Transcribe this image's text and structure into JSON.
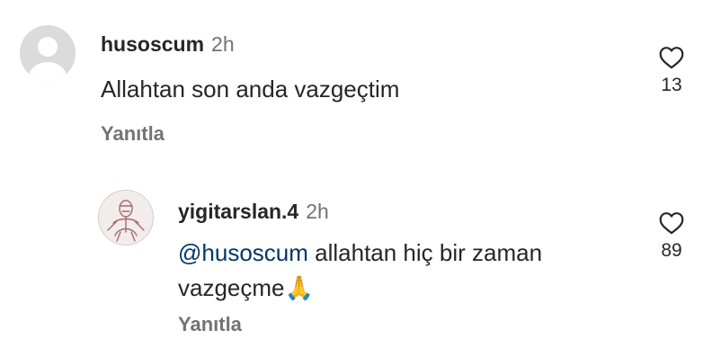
{
  "comments": [
    {
      "username": "husoscum",
      "time": "2h",
      "text": "Allahtan son anda vazgeçtim",
      "reply_label": "Yanıtla",
      "like_count": "13",
      "avatar": "default-avatar-icon"
    },
    {
      "username": "yigitarslan.4",
      "time": "2h",
      "mention": "@husoscum",
      "text_line1": " allahtan hiç bir zaman",
      "text_line2": "vazgeçme",
      "emoji": "🙏",
      "reply_label": "Yanıtla",
      "like_count": "89",
      "avatar": "drawn-portrait-avatar"
    }
  ],
  "colors": {
    "text": "#262626",
    "secondary": "#737373",
    "mention": "#00376b",
    "avatar_placeholder": "#dbdbdb"
  }
}
